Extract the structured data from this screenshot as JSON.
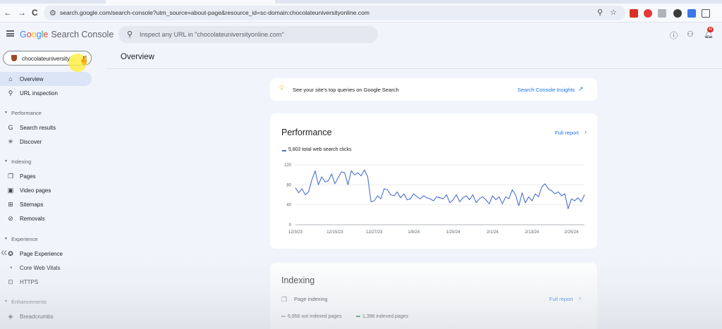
{
  "browser": {
    "url": "search.google.com/search-console?utm_source=about-page&resource_id=sc-domain:chocolateuniversityonline.com",
    "back": "←",
    "forward": "→",
    "reload": "C"
  },
  "header": {
    "logo_google": [
      "G",
      "o",
      "o",
      "g",
      "l",
      "e"
    ],
    "logo_product": "Search Console",
    "search_placeholder": "Inspect any URL in \"chocolateuniversityonline.com\"",
    "notification_count": "40"
  },
  "property": {
    "name": "chocolateuniversity...",
    "caret": "⇵"
  },
  "sidebar": {
    "items_top": [
      {
        "label": "Overview",
        "icon": "home-icon",
        "glyph": "⌂"
      },
      {
        "label": "URL inspection",
        "icon": "search-icon",
        "glyph": "⚲"
      }
    ],
    "sections": [
      {
        "label": "Performance",
        "items": [
          {
            "label": "Search results",
            "icon": "google-g-icon",
            "glyph": "G"
          },
          {
            "label": "Discover",
            "icon": "asterisk-icon",
            "glyph": "✳"
          }
        ]
      },
      {
        "label": "Indexing",
        "items": [
          {
            "label": "Pages",
            "icon": "pages-icon",
            "glyph": "❐"
          },
          {
            "label": "Video pages",
            "icon": "video-pages-icon",
            "glyph": "▣"
          },
          {
            "label": "Sitemaps",
            "icon": "sitemap-icon",
            "glyph": "⊞"
          },
          {
            "label": "Removals",
            "icon": "removals-icon",
            "glyph": "⊘"
          }
        ]
      },
      {
        "label": "Experience",
        "items": [
          {
            "label": "Page Experience",
            "icon": "page-experience-icon",
            "glyph": "✪"
          },
          {
            "label": "Core Web Vitals",
            "icon": "gauge-icon",
            "glyph": "◔"
          },
          {
            "label": "HTTPS",
            "icon": "lock-icon",
            "glyph": "⊡"
          }
        ]
      },
      {
        "label": "Enhancements",
        "items": [
          {
            "label": "Breadcrumbs",
            "icon": "breadcrumbs-icon",
            "glyph": "◈"
          }
        ]
      }
    ]
  },
  "main": {
    "title": "Overview",
    "tip": {
      "text": "See your site's top queries on Google Search",
      "link": "Search Console Insights"
    },
    "performance": {
      "title": "Performance",
      "full_report": "Full report",
      "legend": "5,802 total web search clicks"
    },
    "indexing": {
      "title": "Indexing",
      "subtitle": "Page indexing",
      "full_report": "Full report",
      "legend": [
        "6,956 not indexed pages",
        "1,396 indexed pages"
      ]
    }
  },
  "colors": {
    "accent": "#1a73e8",
    "clicks_series": "#4a6fd1",
    "not_indexed": "#9aa0a6",
    "indexed": "#188038"
  },
  "chart_data": {
    "type": "line",
    "title": "",
    "xlabel": "",
    "ylabel": "",
    "x_ticks": [
      "12/3/23",
      "12/15/23",
      "12/27/23",
      "1/8/24",
      "1/20/24",
      "2/1/24",
      "2/13/24",
      "2/25/24"
    ],
    "y_ticks": [
      0,
      40,
      80,
      120
    ],
    "ylim": [
      0,
      120
    ],
    "grid": true,
    "series": [
      {
        "name": "5,802 total web search clicks",
        "x": [
          "12/3/23",
          "12/4/23",
          "12/5/23",
          "12/6/23",
          "12/7/23",
          "12/8/23",
          "12/9/23",
          "12/10/23",
          "12/11/23",
          "12/12/23",
          "12/13/23",
          "12/14/23",
          "12/15/23",
          "12/16/23",
          "12/17/23",
          "12/18/23",
          "12/19/23",
          "12/20/23",
          "12/21/23",
          "12/22/23",
          "12/23/23",
          "12/24/23",
          "12/25/23",
          "12/26/23",
          "12/27/23",
          "12/28/23",
          "12/29/23",
          "12/30/23",
          "12/31/23",
          "1/1/24",
          "1/2/24",
          "1/3/24",
          "1/4/24",
          "1/5/24",
          "1/6/24",
          "1/7/24",
          "1/8/24",
          "1/9/24",
          "1/10/24",
          "1/11/24",
          "1/12/24",
          "1/13/24",
          "1/14/24",
          "1/15/24",
          "1/16/24",
          "1/17/24",
          "1/18/24",
          "1/19/24",
          "1/20/24",
          "1/21/24",
          "1/22/24",
          "1/23/24",
          "1/24/24",
          "1/25/24",
          "1/26/24",
          "1/27/24",
          "1/28/24",
          "1/29/24",
          "1/30/24",
          "1/31/24",
          "2/1/24",
          "2/2/24",
          "2/3/24",
          "2/4/24",
          "2/5/24",
          "2/6/24",
          "2/7/24",
          "2/8/24",
          "2/9/24",
          "2/10/24",
          "2/11/24",
          "2/12/24",
          "2/13/24",
          "2/14/24",
          "2/15/24",
          "2/16/24",
          "2/17/24",
          "2/18/24",
          "2/19/24",
          "2/20/24",
          "2/21/24",
          "2/22/24",
          "2/23/24",
          "2/24/24",
          "2/25/24",
          "2/26/24",
          "2/27/24",
          "2/28/24",
          "2/29/24"
        ],
        "values": [
          74,
          64,
          72,
          60,
          66,
          90,
          108,
          80,
          96,
          86,
          88,
          102,
          82,
          94,
          106,
          104,
          80,
          108,
          100,
          104,
          98,
          110,
          96,
          46,
          48,
          58,
          52,
          72,
          70,
          60,
          58,
          66,
          54,
          62,
          50,
          52,
          62,
          56,
          52,
          58,
          54,
          52,
          48,
          56,
          54,
          52,
          60,
          44,
          50,
          60,
          46,
          54,
          58,
          50,
          60,
          44,
          52,
          56,
          50,
          42,
          58,
          50,
          56,
          42,
          56,
          52,
          70,
          60,
          38,
          64,
          44,
          56,
          48,
          62,
          56,
          76,
          82,
          72,
          68,
          62,
          66,
          58,
          62,
          32,
          52,
          48,
          54,
          46,
          60
        ]
      }
    ]
  }
}
